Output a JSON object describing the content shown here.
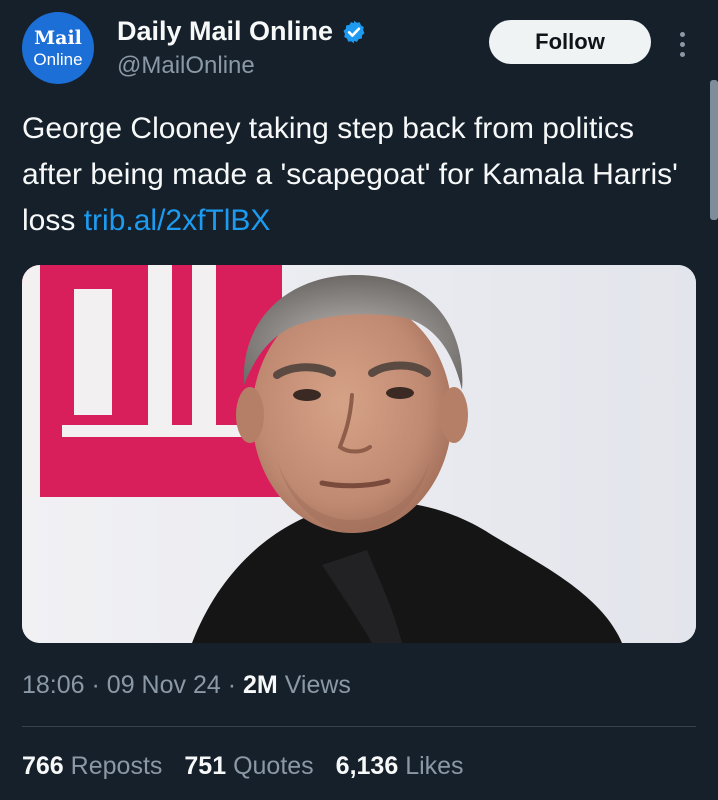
{
  "account": {
    "avatar_line1": "Mail",
    "avatar_line2": "Online",
    "name": "Daily Mail Online",
    "handle": "@MailOnline",
    "verified": true,
    "follow_label": "Follow"
  },
  "tweet": {
    "text": "George Clooney taking step back from politics after being made a 'scapegoat' for Kamala Harris' loss",
    "link": "trib.al/2xfTlBX"
  },
  "meta": {
    "time": "18:06",
    "date": "09 Nov 24",
    "views_count": "2M",
    "views_label": "Views"
  },
  "stats": {
    "reposts_count": "766",
    "reposts_label": "Reposts",
    "quotes_count": "751",
    "quotes_label": "Quotes",
    "likes_count": "6,136",
    "likes_label": "Likes"
  },
  "colors": {
    "background": "#15202b",
    "link": "#1d9bf0",
    "verified": "#1d9bf0",
    "secondary_text": "#8b98a5",
    "banner_pink": "#d81f5b"
  }
}
